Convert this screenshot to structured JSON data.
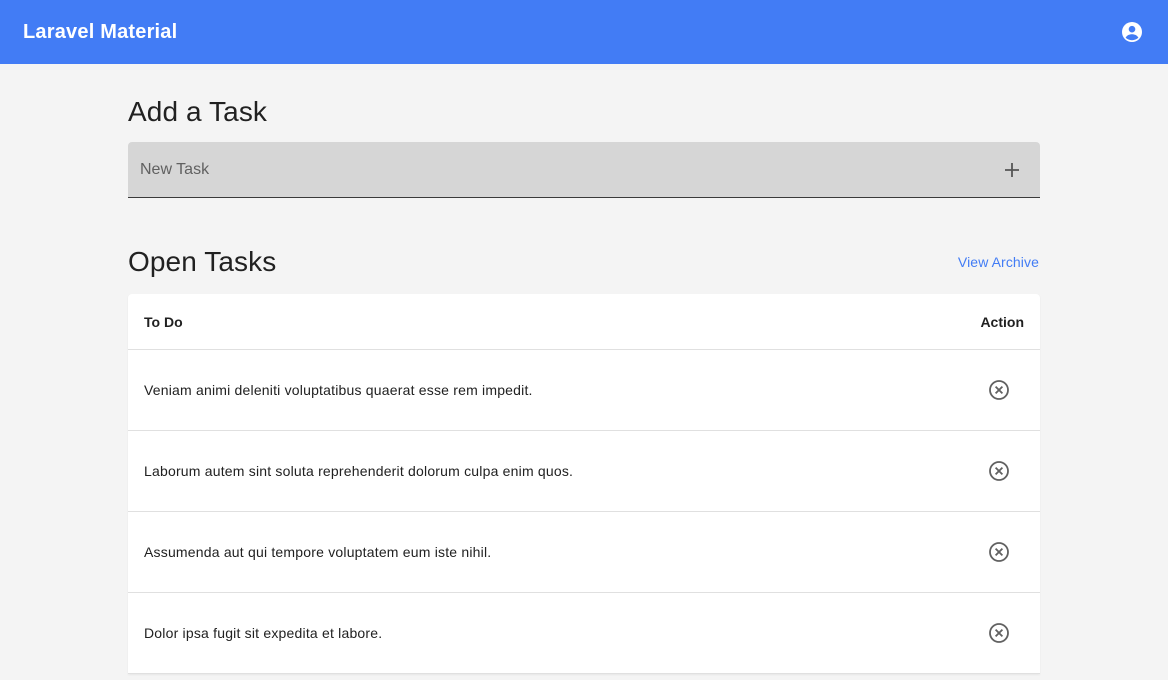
{
  "app_bar": {
    "title": "Laravel Material",
    "account_icon": "account-circle-icon",
    "color": "#427cf5"
  },
  "add_task": {
    "title": "Add a Task",
    "input_placeholder": "New Task",
    "input_value": "",
    "add_icon": "plus-icon"
  },
  "open_tasks": {
    "title": "Open Tasks",
    "view_archive_label": "View Archive",
    "columns": [
      "To Do",
      "Action"
    ],
    "rows": [
      {
        "text": "Veniam animi deleniti voluptatibus quaerat esse rem impedit.",
        "action_icon": "remove-circle-icon"
      },
      {
        "text": "Laborum autem sint soluta reprehenderit dolorum culpa enim quos.",
        "action_icon": "remove-circle-icon"
      },
      {
        "text": "Assumenda aut qui tempore voluptatem eum iste nihil.",
        "action_icon": "remove-circle-icon"
      },
      {
        "text": "Dolor ipsa fugit sit expedita et labore.",
        "action_icon": "remove-circle-icon"
      }
    ]
  }
}
